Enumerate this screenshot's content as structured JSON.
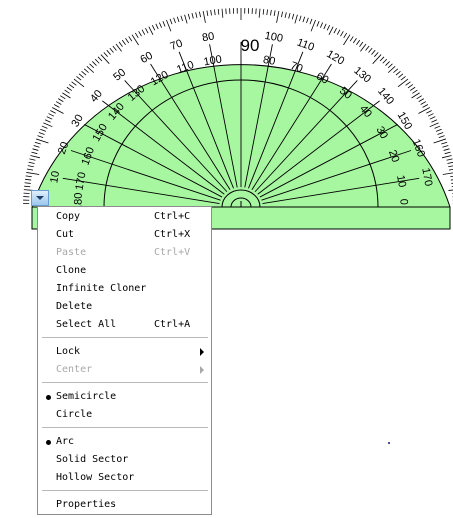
{
  "colors": {
    "protractor_fill": "#a6f7a0",
    "protractor_stroke": "#000000",
    "menu_button": "#9cc7ee"
  },
  "protractor": {
    "center_label": "90",
    "outer_labels": [
      "10",
      "20",
      "30",
      "40",
      "50",
      "60",
      "70",
      "80",
      "100",
      "110",
      "120",
      "130",
      "140",
      "150",
      "160",
      "170"
    ],
    "inner_labels": [
      "0",
      "10",
      "20",
      "30",
      "40",
      "50",
      "60",
      "70",
      "80",
      "100",
      "110",
      "120",
      "130",
      "140",
      "150",
      "160",
      "170",
      "180"
    ]
  },
  "menu_button": {
    "icon": "chevron-down-icon"
  },
  "context_menu": {
    "copy": {
      "label": "Copy",
      "shortcut": "Ctrl+C"
    },
    "cut": {
      "label": "Cut",
      "shortcut": "Ctrl+X"
    },
    "paste": {
      "label": "Paste",
      "shortcut": "Ctrl+V",
      "disabled": true
    },
    "clone": {
      "label": "Clone"
    },
    "infinite_cloner": {
      "label": "Infinite Cloner"
    },
    "delete": {
      "label": "Delete"
    },
    "select_all": {
      "label": "Select All",
      "shortcut": "Ctrl+A"
    },
    "lock": {
      "label": "Lock",
      "submenu": true
    },
    "center": {
      "label": "Center",
      "submenu": true,
      "disabled": true
    },
    "semicircle": {
      "label": "Semicircle",
      "selected": true
    },
    "circle": {
      "label": "Circle",
      "selected": false
    },
    "arc": {
      "label": "Arc",
      "selected": true
    },
    "solid_sector": {
      "label": "Solid Sector",
      "selected": false
    },
    "hollow_sector": {
      "label": "Hollow Sector",
      "selected": false
    },
    "properties": {
      "label": "Properties"
    }
  }
}
